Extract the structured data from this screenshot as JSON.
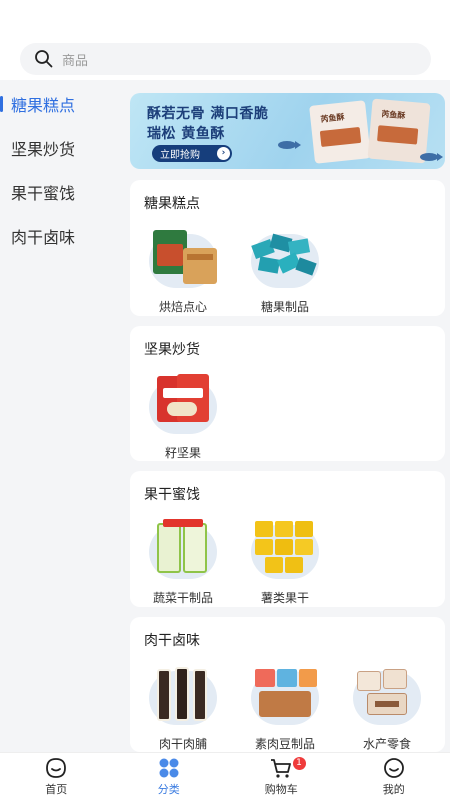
{
  "search": {
    "placeholder": "商品"
  },
  "sidebar": {
    "items": [
      {
        "label": "糖果糕点",
        "active": true
      },
      {
        "label": "坚果炒货",
        "active": false
      },
      {
        "label": "果干蜜饯",
        "active": false
      },
      {
        "label": "肉干卤味",
        "active": false
      }
    ]
  },
  "banner": {
    "line1": "酥若无骨 满口香脆",
    "line2": "瑞松 黄鱼酥",
    "button": "立即抢购",
    "pack_text": "芮鱼酥"
  },
  "sections": [
    {
      "title": "糖果糕点",
      "products": [
        {
          "label": "烘焙点心",
          "icon": "bakery-box-image"
        },
        {
          "label": "糖果制品",
          "icon": "candy-pile-image"
        }
      ]
    },
    {
      "title": "坚果炒货",
      "products": [
        {
          "label": "籽坚果",
          "icon": "peanut-bag-image"
        }
      ]
    },
    {
      "title": "果干蜜饯",
      "products": [
        {
          "label": "蔬菜干制品",
          "icon": "dried-vegetable-image"
        },
        {
          "label": "薯类果干",
          "icon": "sweet-potato-snack-image"
        }
      ]
    },
    {
      "title": "肉干卤味",
      "products": [
        {
          "label": "肉干肉脯",
          "icon": "jerky-image"
        },
        {
          "label": "素肉豆制品",
          "icon": "tofu-snack-image"
        },
        {
          "label": "水产零食",
          "icon": "seafood-snack-image"
        }
      ]
    }
  ],
  "tabbar": {
    "items": [
      {
        "label": "首页",
        "icon": "home-icon"
      },
      {
        "label": "分类",
        "icon": "category-icon",
        "active": true
      },
      {
        "label": "购物车",
        "icon": "cart-icon",
        "badge": "1"
      },
      {
        "label": "我的",
        "icon": "profile-icon"
      }
    ]
  },
  "colors": {
    "accent": "#2f6fe0",
    "badge": "#ef3b3b",
    "banner_bg": "#a9daf1"
  }
}
